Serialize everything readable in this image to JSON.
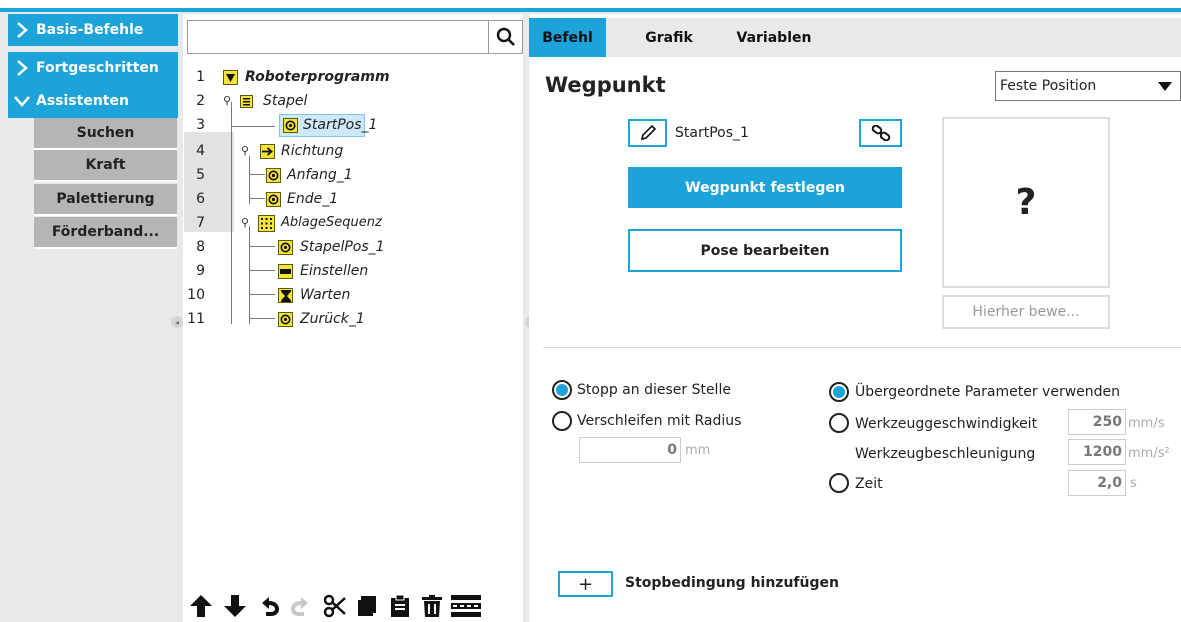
{
  "sidebar": {
    "categories": [
      {
        "label": "Basis-Befehle",
        "expanded": false
      },
      {
        "label": "Fortgeschritten",
        "expanded": false
      },
      {
        "label": "Assistenten",
        "expanded": true
      }
    ],
    "subitems": [
      "Suchen",
      "Kraft",
      "Palettierung",
      "Förderband..."
    ]
  },
  "tree": {
    "rows": [
      {
        "num": "1",
        "label": "Roboterprogramm",
        "icon": "triangle-down-icon"
      },
      {
        "num": "2",
        "label": "Stapel",
        "icon": "stack-icon"
      },
      {
        "num": "3",
        "label": "StartPos_1",
        "icon": "waypoint-icon",
        "selected": true
      },
      {
        "num": "4",
        "label": "Richtung",
        "icon": "arrow-right-icon"
      },
      {
        "num": "5",
        "label": "Anfang_1",
        "icon": "waypoint-icon"
      },
      {
        "num": "6",
        "label": "Ende_1",
        "icon": "waypoint-icon"
      },
      {
        "num": "7",
        "label": "AblageSequenz",
        "icon": "grid-icon"
      },
      {
        "num": "8",
        "label": "StapelPos_1",
        "icon": "waypoint-icon"
      },
      {
        "num": "9",
        "label": "Einstellen",
        "icon": "set-icon"
      },
      {
        "num": "10",
        "label": "Warten",
        "icon": "hourglass-icon"
      },
      {
        "num": "11",
        "label": "Zurück_1",
        "icon": "waypoint-icon"
      }
    ]
  },
  "tabs": [
    "Befehl",
    "Grafik",
    "Variablen"
  ],
  "waypoint": {
    "title": "Wegpunkt",
    "position_type": "Feste Position",
    "name": "StartPos_1",
    "set_button": "Wegpunkt festlegen",
    "edit_pose_button": "Pose bearbeiten",
    "preview_symbol": "?",
    "move_here_button": "Hierher bewe...",
    "stop_option": "Stopp an dieser Stelle",
    "blend_option": "Verschleifen mit Radius",
    "blend_radius": "0",
    "blend_unit": "mm",
    "param_parent": "Übergeordnete Parameter verwenden",
    "tool_speed_label": "Werkzeuggeschwindigkeit",
    "tool_speed_value": "250",
    "tool_speed_unit": "mm/s",
    "tool_accel_label": "Werkzeugbeschleunigung",
    "tool_accel_value": "1200",
    "tool_accel_unit": "mm/s²",
    "time_label": "Zeit",
    "time_value": "2,0",
    "time_unit": "s",
    "add_stop_symbol": "+",
    "add_stop_label": "Stopbedingung hinzufügen"
  },
  "colors": {
    "accent": "#1ba3da",
    "icon_yellow": "#f3e33a"
  }
}
